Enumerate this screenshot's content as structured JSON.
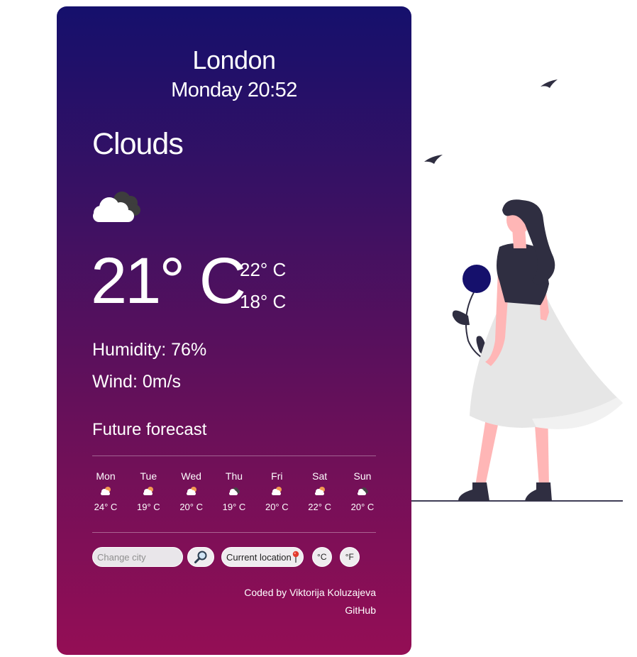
{
  "weather": {
    "city": "London",
    "datetime": "Monday 20:52",
    "condition": "Clouds",
    "current_icon": "clouds-icon",
    "temperature": "21° C",
    "high": "22° C",
    "low": "18° C",
    "humidity": "Humidity: 76%",
    "wind": "Wind: 0m/s"
  },
  "forecast": {
    "title": "Future forecast",
    "days": [
      {
        "day": "Mon",
        "temp": "24° C",
        "icon": "partly-cloudy-icon"
      },
      {
        "day": "Tue",
        "temp": "19° C",
        "icon": "partly-cloudy-icon"
      },
      {
        "day": "Wed",
        "temp": "20° C",
        "icon": "partly-cloudy-icon"
      },
      {
        "day": "Thu",
        "temp": "19° C",
        "icon": "cloudy-icon"
      },
      {
        "day": "Fri",
        "temp": "20° C",
        "icon": "partly-cloudy-icon"
      },
      {
        "day": "Sat",
        "temp": "22° C",
        "icon": "partly-cloudy-icon"
      },
      {
        "day": "Sun",
        "temp": "20° C",
        "icon": "cloudy-icon"
      }
    ]
  },
  "controls": {
    "city_placeholder": "Change city",
    "search_icon": "magnifier-icon",
    "current_location_label": "Current location",
    "location_icon": "pin-icon",
    "celsius_label": "°C",
    "fahrenheit_label": "°F"
  },
  "footer": {
    "credit": "Coded by Viktorija Koluzajeva",
    "github": "GitHub"
  },
  "colors": {
    "gradient_top": "#15106c",
    "gradient_bottom": "#940e55",
    "illustration_dark": "#2f2e41",
    "illustration_skin": "#ffb6b6",
    "illustration_flower": "#15106c"
  }
}
